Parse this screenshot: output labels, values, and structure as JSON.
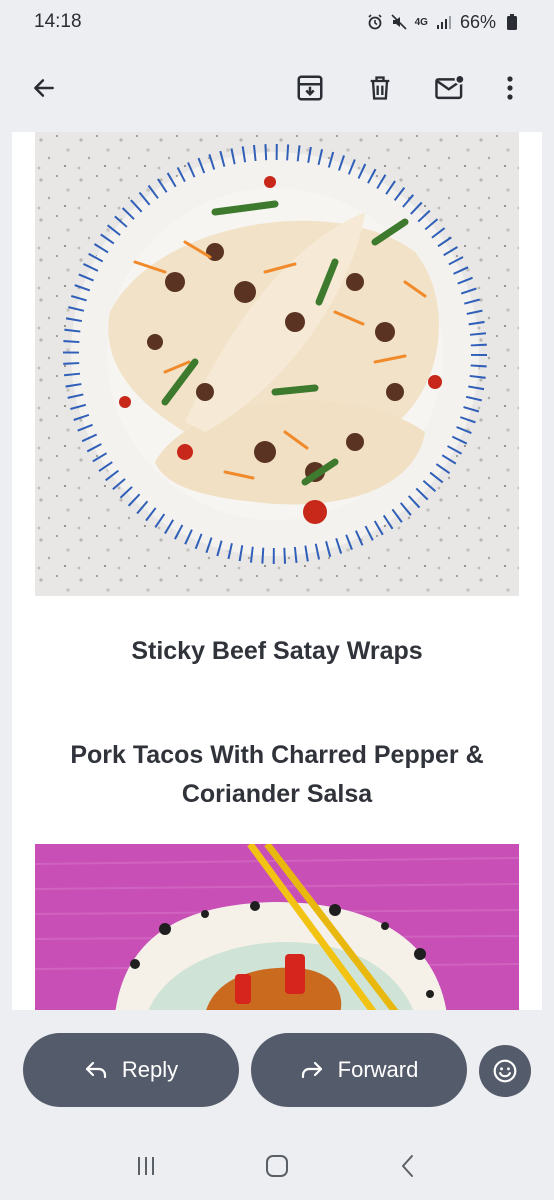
{
  "status_bar": {
    "time": "14:18",
    "network": "4G",
    "battery": "66%",
    "icons": [
      "alarm-icon",
      "mute-icon",
      "signal-icon",
      "battery-icon"
    ]
  },
  "toolbar": {
    "icons": [
      "back-arrow-icon",
      "archive-icon",
      "delete-icon",
      "mark-unread-icon",
      "more-vert-icon"
    ]
  },
  "email": {
    "recipes": [
      {
        "title": "Sticky Beef Satay Wraps",
        "image": "beef-satay-wraps-photo"
      },
      {
        "title": "Pork Tacos With Charred Pepper & Coriander Salsa",
        "image": "rice-bowl-with-chopsticks-photo"
      }
    ]
  },
  "actions": {
    "reply_label": "Reply",
    "forward_label": "Forward"
  },
  "system_nav": {
    "icons": [
      "recents-icon",
      "home-icon",
      "back-icon"
    ]
  },
  "colors": {
    "background": "#eceef1",
    "pill": "#545b6a",
    "title_text": "#30333a",
    "plate_stripe": "#2f5fb8",
    "purple_backdrop": "#c74fb6"
  }
}
